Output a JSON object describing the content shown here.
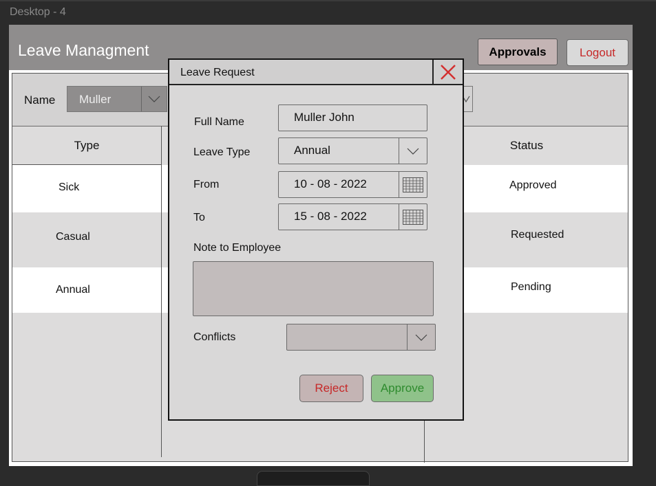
{
  "frame": {
    "label": "Desktop - 4"
  },
  "header": {
    "title": "Leave Managment",
    "approvals_label": "Approvals",
    "logout_label": "Logout"
  },
  "filter": {
    "name_label": "Name",
    "name_value": "Muller",
    "name_icon": "chevron-down-icon"
  },
  "table": {
    "columns": [
      "Type",
      "Status"
    ],
    "rows": [
      {
        "type": "Sick",
        "status": "Approved"
      },
      {
        "type": "Casual",
        "status": "Requested"
      },
      {
        "type": "Annual",
        "status": "Pending"
      }
    ]
  },
  "modal": {
    "title": "Leave Request",
    "close_icon": "close-icon",
    "full_name_label": "Full Name",
    "full_name_value": "Muller John",
    "leave_type_label": "Leave Type",
    "leave_type_value": "Annual",
    "from_label": "From",
    "from_value": "10 - 08 - 2022",
    "to_label": "To",
    "to_value": "15 - 08 - 2022",
    "note_label": "Note to Employee",
    "note_value": "",
    "conflicts_label": "Conflicts",
    "conflicts_value": "",
    "reject_label": "Reject",
    "approve_label": "Approve"
  },
  "colors": {
    "header_bg": "#8f8d8d",
    "reject_text": "#c62828",
    "approve_text": "#2e8b2e",
    "approve_bg": "#8fc28a",
    "reject_bg": "#c4b4b4"
  }
}
